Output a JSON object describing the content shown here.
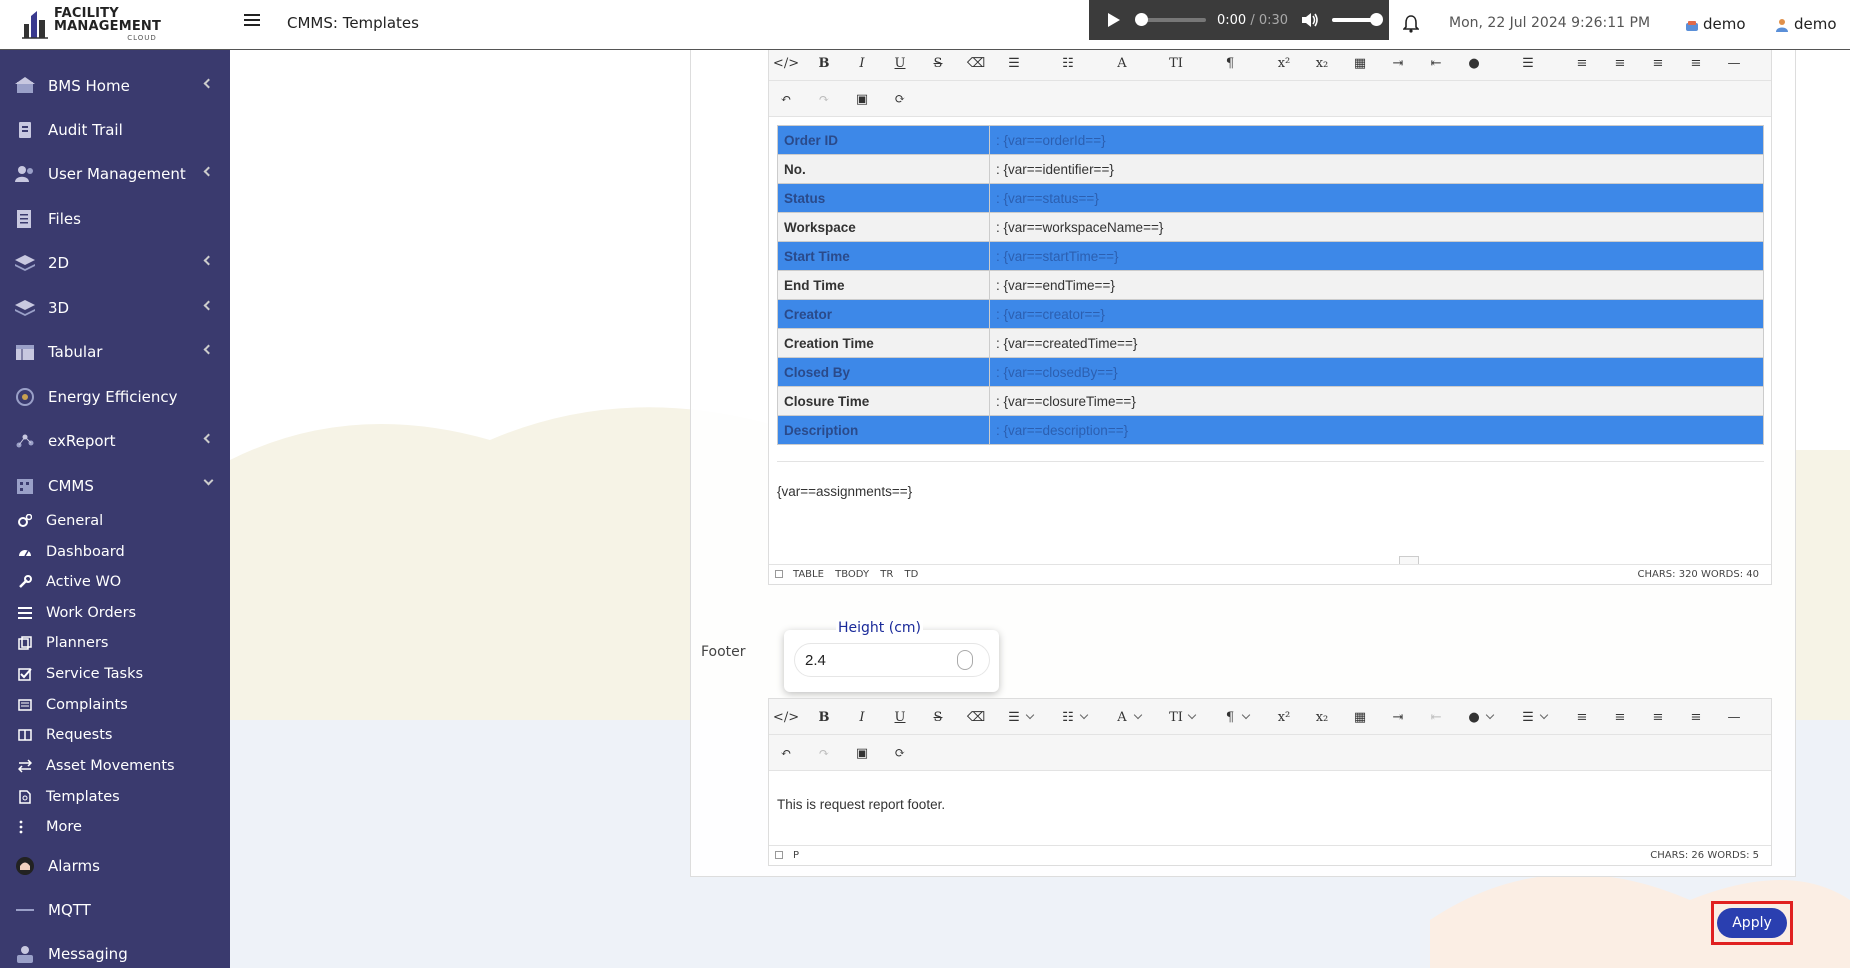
{
  "header": {
    "logo_line1": "FACILITY MANAGEMENT",
    "logo_line2": "CLOUD",
    "page_title": "CMMS: Templates",
    "player_time": "0:00",
    "player_sep": " / ",
    "player_duration": "0:30",
    "datetime": "Mon, 22 Jul 2024 9:26:11 PM",
    "user_site": "demo",
    "user_name": "demo"
  },
  "sidebar": {
    "items": [
      {
        "label": "BMS Home",
        "icon": "home-icon"
      },
      {
        "label": "Audit Trail",
        "icon": "audit-icon"
      },
      {
        "label": "User Management",
        "icon": "users-icon"
      },
      {
        "label": "Files",
        "icon": "files-icon"
      },
      {
        "label": "2D",
        "icon": "layers-icon"
      },
      {
        "label": "3D",
        "icon": "layers3d-icon"
      },
      {
        "label": "Tabular",
        "icon": "table-icon"
      },
      {
        "label": "Energy Efficiency",
        "icon": "energy-icon"
      },
      {
        "label": "exReport",
        "icon": "report-icon"
      },
      {
        "label": "CMMS",
        "icon": "cmms-icon"
      }
    ],
    "cmms_sub": [
      {
        "label": "General"
      },
      {
        "label": "Dashboard"
      },
      {
        "label": "Active WO"
      },
      {
        "label": "Work Orders"
      },
      {
        "label": "Planners"
      },
      {
        "label": "Service Tasks"
      },
      {
        "label": "Complaints"
      },
      {
        "label": "Requests"
      },
      {
        "label": "Asset Movements"
      },
      {
        "label": "Templates"
      },
      {
        "label": "More"
      }
    ],
    "bottom": [
      {
        "label": "Alarms"
      },
      {
        "label": "MQTT"
      },
      {
        "label": "Messaging"
      }
    ]
  },
  "body_editor": {
    "rows": [
      {
        "key": "Order ID",
        "value": ": {var==orderId==}",
        "highlight": true
      },
      {
        "key": "No.",
        "value": ": {var==identifier==}",
        "highlight": false
      },
      {
        "key": "Status",
        "value": ": {var==status==}",
        "highlight": true
      },
      {
        "key": "Workspace",
        "value": ": {var==workspaceName==}",
        "highlight": false
      },
      {
        "key": "Start Time",
        "value": ": {var==startTime==}",
        "highlight": true
      },
      {
        "key": "End Time",
        "value": ": {var==endTime==}",
        "highlight": false
      },
      {
        "key": "Creator",
        "value": ": {var==creator==}",
        "highlight": true
      },
      {
        "key": "Creation Time",
        "value": ": {var==createdTime==}",
        "highlight": false
      },
      {
        "key": "Closed By",
        "value": ": {var==closedBy==}",
        "highlight": true
      },
      {
        "key": "Closure Time",
        "value": ": {var==closureTime==}",
        "highlight": false
      },
      {
        "key": "Description",
        "value": ": {var==description==}",
        "highlight": true
      }
    ],
    "assignments": "{var==assignments==}",
    "path": [
      "TABLE",
      "TBODY",
      "TR",
      "TD"
    ],
    "counts": "CHARS: 320   WORDS: 40"
  },
  "footer": {
    "label": "Footer",
    "height_label": "Height (cm)",
    "height_value": "2.4",
    "text": "This is request report footer.",
    "path": [
      "P"
    ],
    "counts": "CHARS: 26   WORDS: 5"
  },
  "toolbar_glyphs": {
    "bold": "B",
    "italic": "I",
    "underline": "U",
    "strike": "S",
    "font": "A",
    "size": "TI",
    "para": "¶",
    "sup": "x²",
    "sub": "x₂"
  },
  "apply_label": "Apply"
}
